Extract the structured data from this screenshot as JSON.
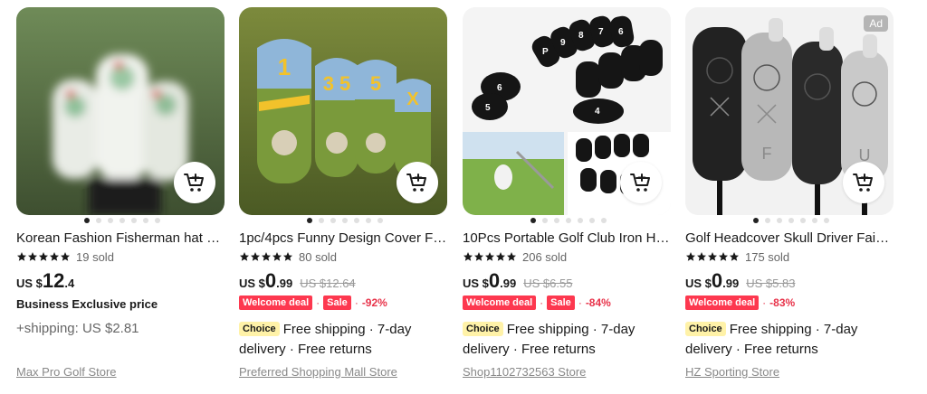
{
  "cart_icon": "cart-add-icon",
  "star_color": "#191919",
  "cards": [
    {
      "title": "Korean Fashion Fisherman hat G…",
      "sold": "19 sold",
      "price_currency": "US $",
      "price_int": "12",
      "price_dec": ".4",
      "business_label": "Business Exclusive price",
      "shipping": "+shipping: US $2.81",
      "store": "Max Pro Golf Store"
    },
    {
      "title": "1pc/4pcs Funny Design Cover Fo…",
      "sold": "80 sold",
      "price_currency": "US $",
      "price_int": "0",
      "price_dec": ".99",
      "price_old": "US $12.64",
      "welcome": "Welcome deal",
      "sale": "Sale",
      "separator": "·",
      "discount": "-92%",
      "choice": "Choice",
      "shipping": "Free shipping · 7-day delivery · Free returns",
      "store": "Preferred Shopping Mall Store"
    },
    {
      "title": "10Pcs Portable Golf Club Iron He…",
      "sold": "206 sold",
      "price_currency": "US $",
      "price_int": "0",
      "price_dec": ".99",
      "price_old": "US $6.55",
      "welcome": "Welcome deal",
      "sale": "Sale",
      "separator": "·",
      "discount": "-84%",
      "choice": "Choice",
      "shipping": "Free shipping · 7-day delivery · Free returns",
      "store": "Shop1102732563 Store"
    },
    {
      "title": "Golf Headcover Skull Driver Fair…",
      "sold": "175 sold",
      "price_currency": "US $",
      "price_int": "0",
      "price_dec": ".99",
      "price_old": "US $5.83",
      "welcome": "Welcome deal",
      "separator": "·",
      "discount": "-83%",
      "choice": "Choice",
      "shipping": "Free shipping · 7-day delivery · Free returns",
      "store": "HZ Sporting Store",
      "ad_badge": "Ad"
    }
  ]
}
